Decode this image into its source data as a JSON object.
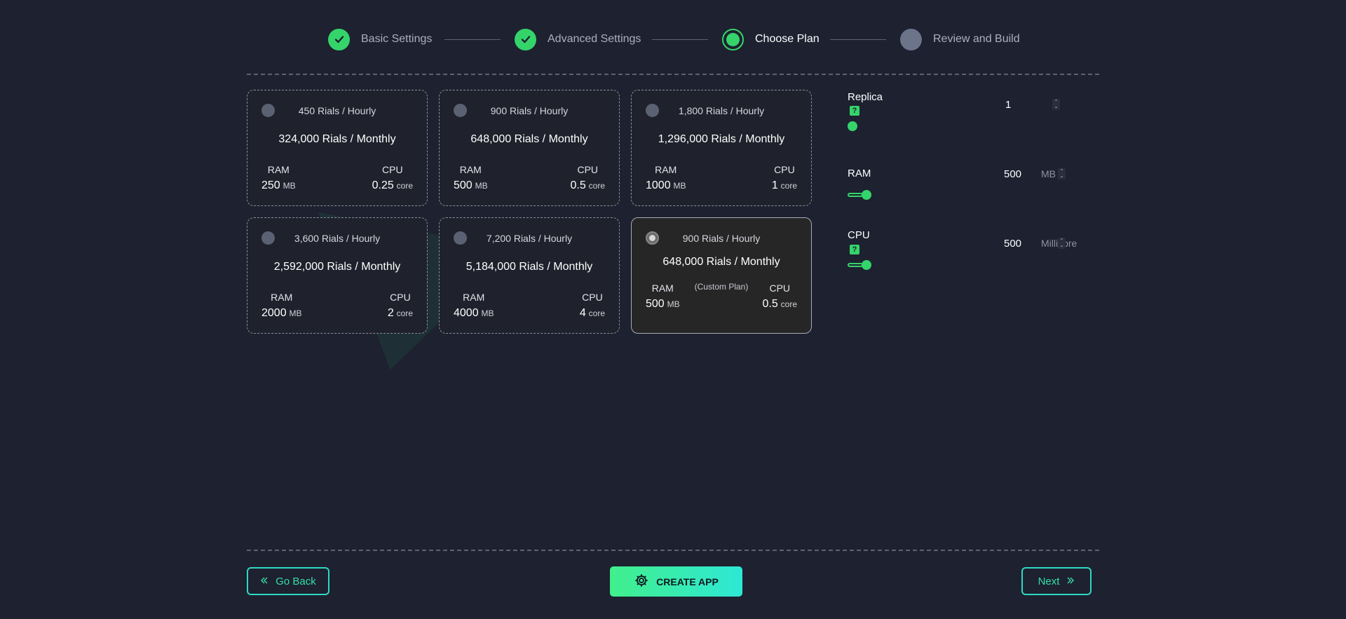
{
  "stepper": {
    "steps": [
      {
        "label": "Basic Settings",
        "state": "done"
      },
      {
        "label": "Advanced Settings",
        "state": "done"
      },
      {
        "label": "Choose Plan",
        "state": "active"
      },
      {
        "label": "Review and Build",
        "state": "todo"
      }
    ]
  },
  "plans": [
    {
      "hourly": "450 Rials / Hourly",
      "monthly": "324,000 Rials / Monthly",
      "ram_label": "RAM",
      "ram_value": "250",
      "ram_unit": "MB",
      "cpu_label": "CPU",
      "cpu_value": "0.25",
      "cpu_unit": "core"
    },
    {
      "hourly": "900 Rials / Hourly",
      "monthly": "648,000 Rials / Monthly",
      "ram_label": "RAM",
      "ram_value": "500",
      "ram_unit": "MB",
      "cpu_label": "CPU",
      "cpu_value": "0.5",
      "cpu_unit": "core"
    },
    {
      "hourly": "1,800 Rials / Hourly",
      "monthly": "1,296,000 Rials / Monthly",
      "ram_label": "RAM",
      "ram_value": "1000",
      "ram_unit": "MB",
      "cpu_label": "CPU",
      "cpu_value": "1",
      "cpu_unit": "core"
    },
    {
      "hourly": "3,600 Rials / Hourly",
      "monthly": "2,592,000 Rials / Monthly",
      "ram_label": "RAM",
      "ram_value": "2000",
      "ram_unit": "MB",
      "cpu_label": "CPU",
      "cpu_value": "2",
      "cpu_unit": "core"
    },
    {
      "hourly": "7,200 Rials / Hourly",
      "monthly": "5,184,000 Rials / Monthly",
      "ram_label": "RAM",
      "ram_value": "4000",
      "ram_unit": "MB",
      "cpu_label": "CPU",
      "cpu_value": "4",
      "cpu_unit": "core"
    },
    {
      "hourly": "900 Rials / Hourly",
      "monthly": "648,000 Rials / Monthly",
      "tag": "(Custom Plan)",
      "ram_label": "RAM",
      "ram_value": "500",
      "ram_unit": "MB",
      "cpu_label": "CPU",
      "cpu_value": "0.5",
      "cpu_unit": "core",
      "selected": true
    }
  ],
  "settings": {
    "replica": {
      "label": "Replica",
      "help_icon": "question-icon",
      "value": "1"
    },
    "ram": {
      "label": "RAM",
      "value": "500",
      "unit": "MB"
    },
    "cpu": {
      "label": "CPU",
      "help_icon": "question-icon",
      "value": "500",
      "unit": "Millicore"
    }
  },
  "actions": {
    "back_label": "Go Back",
    "create_label": "CREATE APP",
    "next_label": "Next"
  },
  "colors": {
    "background": "#1d2130",
    "accent": "#35d46a",
    "accent_teal": "#2fd9c3",
    "pending_step": "#6b7489"
  }
}
